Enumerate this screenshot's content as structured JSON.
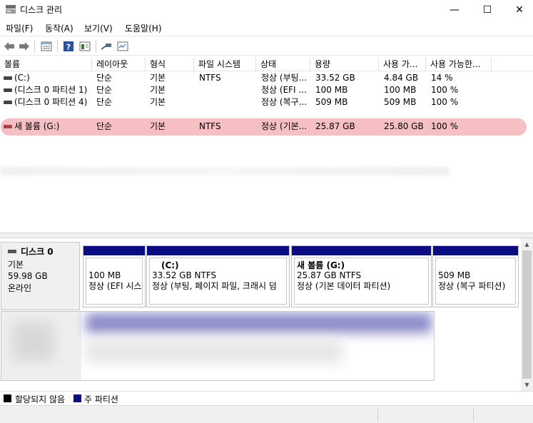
{
  "window": {
    "title": "디스크 관리",
    "minimize": "—",
    "maximize": "☐",
    "close": "✕"
  },
  "menu": [
    "파일(F)",
    "동작(A)",
    "보기(V)",
    "도움말(H)"
  ],
  "toolbar": [
    "back-icon",
    "forward-icon",
    "list-view-icon",
    "help-icon",
    "properties-icon",
    "connect-icon",
    "settings-icon"
  ],
  "columns": [
    "볼륨",
    "레이아웃",
    "형식",
    "파일 시스템",
    "상태",
    "용량",
    "사용 가...",
    "사용 가능한..."
  ],
  "volumes": [
    {
      "name": "(C:)",
      "layout": "단순",
      "type": "기본",
      "fs": "NTFS",
      "status": "정상 (부팅...",
      "capacity": "33.52 GB",
      "free": "4.84 GB",
      "pct": "14 %"
    },
    {
      "name": "(디스크 0 파티션 1)",
      "layout": "단순",
      "type": "기본",
      "fs": "",
      "status": "정상 (EFI ...",
      "capacity": "100 MB",
      "free": "100 MB",
      "pct": "100 %"
    },
    {
      "name": "(디스크 0 파티션 4)",
      "layout": "단순",
      "type": "기본",
      "fs": "",
      "status": "정상 (복구...",
      "capacity": "509 MB",
      "free": "509 MB",
      "pct": "100 %"
    },
    {
      "name": "새 볼륨 (G:)",
      "layout": "단순",
      "type": "기본",
      "fs": "NTFS",
      "status": "정상 (기본...",
      "capacity": "25.87 GB",
      "free": "25.80 GB",
      "pct": "100 %",
      "selected": true
    }
  ],
  "disk0": {
    "name": "디스크 0",
    "type": "기본",
    "size": "59.98 GB",
    "state": "온라인",
    "partitions": [
      {
        "title": "",
        "size": "100 MB",
        "status": "정상 (EFI 시스"
      },
      {
        "title": "(C:)",
        "size": "33.52 GB NTFS",
        "status": "정상 (부팅, 페이지 파일, 크래시 덤"
      },
      {
        "title": "새 볼륨  (G:)",
        "size": "25.87 GB NTFS",
        "status": "정상 (기본 데이터 파티션)"
      },
      {
        "title": "",
        "size": "509 MB",
        "status": "정상 (복구 파티션)"
      }
    ]
  },
  "legend": [
    {
      "label": "할당되지 않음",
      "color": "#000000"
    },
    {
      "label": "주 파티션",
      "color": "#0b0b82"
    }
  ],
  "colors": {
    "partition_bar": "#0b0b82",
    "selection": "#f5b4b8"
  }
}
